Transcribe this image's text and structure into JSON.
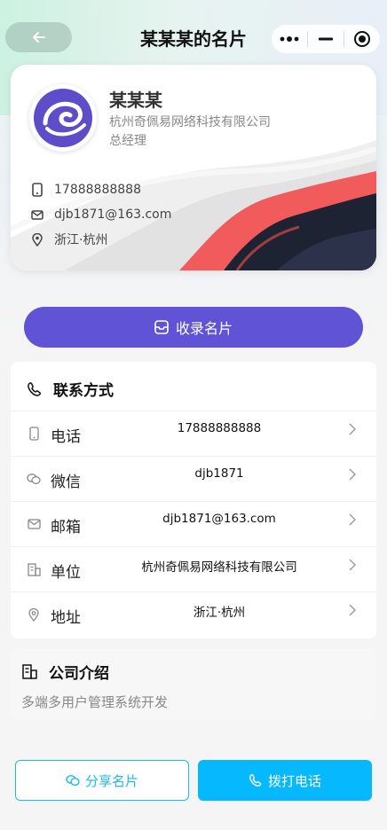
{
  "header": {
    "title": "某某某的名片",
    "back_icon": "arrow-left-icon",
    "menu_icons": [
      "more-dots-icon",
      "minimize-icon",
      "close-target-icon"
    ]
  },
  "card": {
    "name": "某某某",
    "company": "杭州奇佩易网络科技有限公司",
    "position": "总经理",
    "phone": "17888888888",
    "email": "djb1871@163.com",
    "address": "浙江·杭州",
    "logo_icon": "company-logo-icon",
    "accent_colors": [
      "#6153d6",
      "#f25b5b",
      "#1e2333"
    ]
  },
  "collect_button": {
    "label": "收录名片",
    "icon": "card-box-icon",
    "color": "#6153d6"
  },
  "contact": {
    "title": "联系方式",
    "rows": [
      {
        "label": "电话",
        "value": "17888888888",
        "icon": "phone-icon"
      },
      {
        "label": "微信",
        "value": "djb1871",
        "icon": "wechat-icon"
      },
      {
        "label": "邮箱",
        "value": "djb1871@163.com",
        "icon": "mail-icon"
      },
      {
        "label": "单位",
        "value": "杭州奇佩易网络科技有限公司",
        "icon": "building-icon"
      },
      {
        "label": "地址",
        "value": "浙江·杭州",
        "icon": "location-icon"
      }
    ]
  },
  "intro": {
    "title": "公司介绍",
    "text": "多端多用户管理系统开发"
  },
  "bottom": {
    "share_label": "分享名片",
    "call_label": "拨打电话",
    "accent": "#06b8fd"
  }
}
